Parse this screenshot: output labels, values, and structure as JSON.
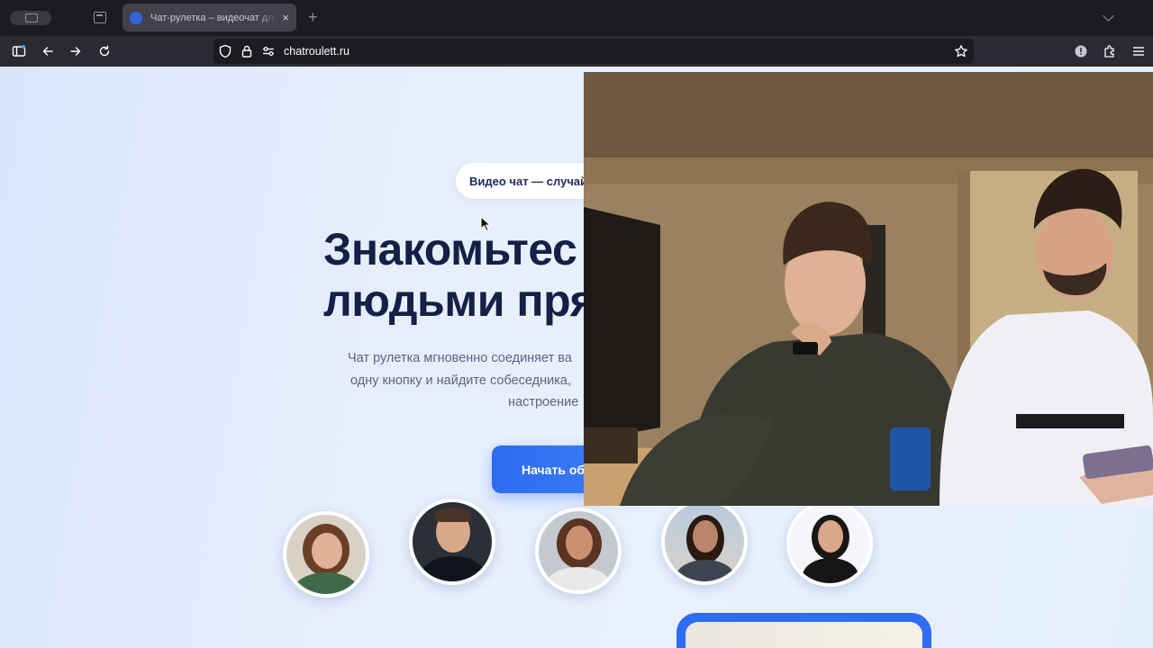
{
  "browser": {
    "tab_title": "Чат-рулетка – видеочат для случайного общения",
    "tab_close": "×",
    "new_tab": "+",
    "url": "chatroulett.ru"
  },
  "hero": {
    "badge": "Видео чат — случай",
    "heading_line1": "Знакомьтес",
    "heading_line2": "людьми пря",
    "lead_line1": "Чат рулетка мгновенно соединяет ва",
    "lead_line2": "одну кнопку и найдите собеседника,",
    "lead_line3": "настроение",
    "cta": "Начать об"
  },
  "avatars": [
    {
      "name": "avatar-1"
    },
    {
      "name": "avatar-2"
    },
    {
      "name": "avatar-3"
    },
    {
      "name": "avatar-4"
    },
    {
      "name": "avatar-5"
    }
  ],
  "colors": {
    "accent": "#2f6bf0",
    "heading": "#142045",
    "browser_chrome": "#2b2a33"
  }
}
